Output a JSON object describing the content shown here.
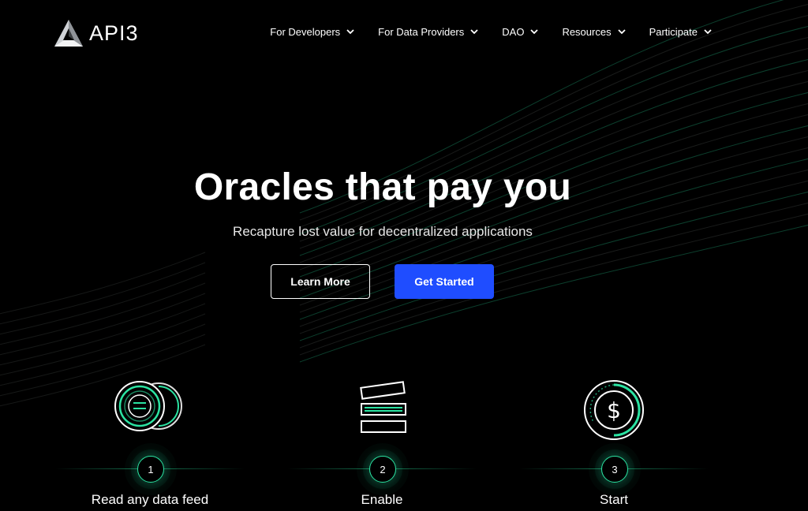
{
  "brand": {
    "name": "API3",
    "logo_icon": "api3-triangle-logo-icon"
  },
  "nav": {
    "items": [
      {
        "label": "For Developers",
        "icon": "chevron-down-icon"
      },
      {
        "label": "For Data Providers",
        "icon": "chevron-down-icon"
      },
      {
        "label": "DAO",
        "icon": "chevron-down-icon"
      },
      {
        "label": "Resources",
        "icon": "chevron-down-icon"
      },
      {
        "label": "Participate",
        "icon": "chevron-down-icon"
      }
    ]
  },
  "hero": {
    "title": "Oracles that pay you",
    "subtitle": "Recapture lost value for decentralized applications"
  },
  "buttons": {
    "learn_more": "Learn More",
    "get_started": "Get Started"
  },
  "steps": [
    {
      "number": "1",
      "label": "Read any data feed",
      "icon": "coins-icon"
    },
    {
      "number": "2",
      "label": "Enable",
      "icon": "stacked-layers-icon"
    },
    {
      "number": "3",
      "label": "Start",
      "icon": "dollar-coin-icon"
    }
  ],
  "colors": {
    "background": "#000000",
    "accent_green": "#2be3a2",
    "primary_button": "#1f4dff",
    "text": "#ffffff"
  }
}
